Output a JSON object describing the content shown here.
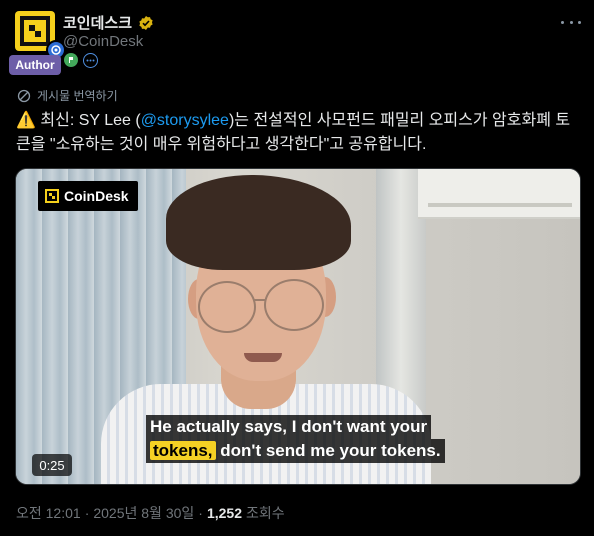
{
  "author": {
    "display_name": "코인데스크",
    "handle": "@CoinDesk",
    "badge_label": "Author",
    "verified_color": "#d9b310",
    "avatar_icon": "coindesk-logo-icon"
  },
  "translate_label": "게시물 번역하기",
  "tweet": {
    "emoji": "⚠️",
    "prefix": "최신: SY Lee (",
    "mention": "@storysylee",
    "suffix": ")는 전설적인 사모펀드 패밀리 오피스가 암호화폐 토큰을 \"소유하는 것이 매우 위험하다고 생각한다\"고 공유합니다."
  },
  "media": {
    "logo_text": "CoinDesk",
    "caption_line1": "He actually says, I don't want your",
    "caption_highlight": "tokens,",
    "caption_line2_rest": " don't send me your tokens.",
    "duration": "0:25"
  },
  "meta": {
    "time": "오전 12:01",
    "date": "2025년 8월 30일",
    "views_count": "1,252",
    "views_label": "조회수"
  }
}
